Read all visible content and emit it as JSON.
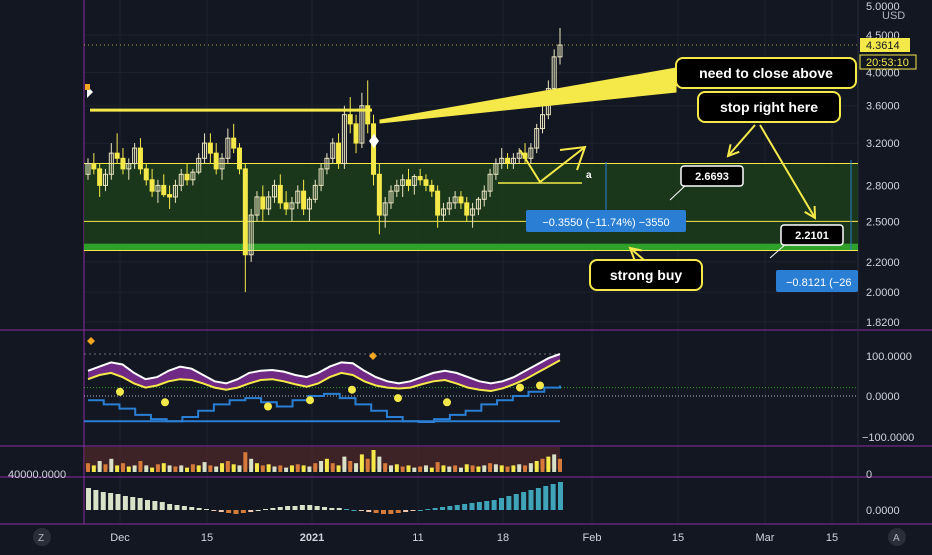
{
  "chart_data": {
    "type": "candlestick",
    "currency": "USD",
    "price_axis": {
      "ticks": [
        "5.0000",
        "4.5000",
        "4.0000",
        "3.6000",
        "3.2000",
        "2.8000",
        "2.5000",
        "2.2000",
        "2.0000",
        "1.8200"
      ],
      "scale": "log"
    },
    "last_price": "4.3614",
    "countdown": "20:53:10",
    "price_labels": {
      "hi": "4.5000",
      "lo": "4.0000"
    },
    "x_axis": {
      "ticks": [
        "Dec",
        "15",
        "2021",
        "11",
        "18",
        "Feb",
        "15",
        "Mar",
        "15"
      ]
    },
    "candles": [
      [
        2.9,
        3.05,
        2.85,
        3.0
      ],
      [
        3.0,
        3.1,
        2.9,
        2.95
      ],
      [
        2.95,
        3.0,
        2.7,
        2.8
      ],
      [
        2.8,
        2.95,
        2.75,
        2.9
      ],
      [
        2.9,
        3.2,
        2.85,
        3.1
      ],
      [
        3.1,
        3.3,
        3.0,
        3.05
      ],
      [
        3.05,
        3.15,
        2.9,
        2.95
      ],
      [
        2.95,
        3.05,
        2.85,
        3.0
      ],
      [
        3.0,
        3.2,
        2.95,
        3.15
      ],
      [
        3.15,
        3.25,
        2.9,
        2.95
      ],
      [
        2.95,
        3.0,
        2.8,
        2.85
      ],
      [
        2.85,
        2.95,
        2.7,
        2.75
      ],
      [
        2.75,
        2.85,
        2.65,
        2.8
      ],
      [
        2.8,
        2.9,
        2.7,
        2.72
      ],
      [
        2.72,
        2.8,
        2.6,
        2.7
      ],
      [
        2.7,
        2.85,
        2.65,
        2.8
      ],
      [
        2.8,
        2.95,
        2.75,
        2.9
      ],
      [
        2.9,
        3.0,
        2.8,
        2.85
      ],
      [
        2.85,
        2.95,
        2.8,
        2.92
      ],
      [
        2.92,
        3.1,
        2.9,
        3.05
      ],
      [
        3.05,
        3.3,
        3.0,
        3.2
      ],
      [
        3.2,
        3.3,
        3.0,
        3.1
      ],
      [
        3.1,
        3.2,
        2.9,
        2.95
      ],
      [
        2.95,
        3.1,
        2.85,
        3.05
      ],
      [
        3.05,
        3.35,
        3.0,
        3.25
      ],
      [
        3.25,
        3.4,
        3.1,
        3.15
      ],
      [
        3.15,
        3.2,
        2.9,
        2.95
      ],
      [
        2.95,
        3.0,
        2.0,
        2.25
      ],
      [
        2.25,
        2.6,
        2.2,
        2.55
      ],
      [
        2.55,
        2.75,
        2.5,
        2.7
      ],
      [
        2.7,
        2.8,
        2.5,
        2.6
      ],
      [
        2.6,
        2.75,
        2.55,
        2.7
      ],
      [
        2.7,
        2.85,
        2.65,
        2.8
      ],
      [
        2.8,
        2.9,
        2.6,
        2.65
      ],
      [
        2.65,
        2.75,
        2.55,
        2.6
      ],
      [
        2.6,
        2.7,
        2.5,
        2.65
      ],
      [
        2.65,
        2.8,
        2.6,
        2.75
      ],
      [
        2.75,
        2.85,
        2.55,
        2.6
      ],
      [
        2.6,
        2.7,
        2.5,
        2.68
      ],
      [
        2.68,
        2.85,
        2.65,
        2.8
      ],
      [
        2.8,
        3.0,
        2.75,
        2.95
      ],
      [
        2.95,
        3.1,
        2.9,
        3.05
      ],
      [
        3.05,
        3.25,
        3.0,
        3.2
      ],
      [
        3.2,
        3.3,
        2.95,
        3.0
      ],
      [
        3.0,
        3.6,
        2.95,
        3.5
      ],
      [
        3.5,
        3.7,
        3.3,
        3.4
      ],
      [
        3.4,
        3.5,
        3.1,
        3.2
      ],
      [
        3.2,
        3.75,
        3.15,
        3.6
      ],
      [
        3.6,
        3.9,
        3.3,
        3.4
      ],
      [
        3.4,
        3.5,
        2.8,
        2.9
      ],
      [
        2.9,
        3.0,
        2.4,
        2.55
      ],
      [
        2.55,
        2.7,
        2.45,
        2.65
      ],
      [
        2.65,
        2.8,
        2.6,
        2.75
      ],
      [
        2.75,
        2.85,
        2.7,
        2.8
      ],
      [
        2.8,
        2.9,
        2.7,
        2.85
      ],
      [
        2.85,
        2.95,
        2.75,
        2.8
      ],
      [
        2.8,
        2.9,
        2.72,
        2.88
      ],
      [
        2.88,
        2.95,
        2.8,
        2.85
      ],
      [
        2.85,
        2.9,
        2.75,
        2.8
      ],
      [
        2.8,
        2.85,
        2.7,
        2.75
      ],
      [
        2.75,
        2.8,
        2.45,
        2.55
      ],
      [
        2.55,
        2.65,
        2.5,
        2.6
      ],
      [
        2.6,
        2.7,
        2.55,
        2.65
      ],
      [
        2.65,
        2.75,
        2.6,
        2.7
      ],
      [
        2.7,
        2.75,
        2.6,
        2.65
      ],
      [
        2.65,
        2.7,
        2.5,
        2.55
      ],
      [
        2.55,
        2.65,
        2.45,
        2.6
      ],
      [
        2.6,
        2.7,
        2.55,
        2.68
      ],
      [
        2.68,
        2.8,
        2.62,
        2.75
      ],
      [
        2.75,
        2.95,
        2.7,
        2.9
      ],
      [
        2.9,
        3.05,
        2.85,
        3.0
      ],
      [
        3.0,
        3.15,
        2.95,
        3.05
      ],
      [
        3.05,
        3.1,
        2.95,
        3.0
      ],
      [
        3.0,
        3.1,
        2.95,
        3.05
      ],
      [
        3.05,
        3.15,
        3.0,
        3.1
      ],
      [
        3.1,
        3.2,
        3.0,
        3.05
      ],
      [
        3.05,
        3.2,
        3.0,
        3.15
      ],
      [
        3.15,
        3.4,
        3.1,
        3.35
      ],
      [
        3.35,
        3.6,
        3.3,
        3.5
      ],
      [
        3.5,
        3.9,
        3.45,
        3.8
      ],
      [
        3.8,
        4.3,
        3.75,
        4.2
      ],
      [
        4.2,
        4.6,
        4.1,
        4.36
      ]
    ],
    "overlays": {
      "resistance_price": 3.55,
      "band_top": 3.0,
      "band_bottom": 2.3,
      "inner_line": 2.5,
      "green_zone": [
        2.28,
        2.33
      ]
    },
    "annotations": {
      "callout1": "need to close above",
      "callout2": "stop right here",
      "callout3": "strong buy",
      "label_a": "a",
      "price_tag1": "2.6693",
      "price_tag2": "2.2101",
      "measure1": "−0.3550 (−11.74%) −3550",
      "measure2": "−0.8121 (−26"
    },
    "osc_axis": [
      "100.0000",
      "0.0000",
      "−100.0000"
    ],
    "vol_axis_left": "40000.0000",
    "vol_axis_right": "0",
    "hist_axis": "0.0000",
    "corner_z": "Z",
    "corner_a": "A"
  },
  "colors": {
    "bg": "#131722",
    "grid": "#1e2230",
    "yellow": "#f5e94a",
    "candle_up": "#e9e4c0",
    "band_fill": "#1c3d1a",
    "green_zone": "#2fa12a",
    "blue_box": "#2a7fd4",
    "purple": "#8a2ea0",
    "teal": "#3fa4b8",
    "cream": "#d9e2c8",
    "orange": "#d57a3a"
  }
}
